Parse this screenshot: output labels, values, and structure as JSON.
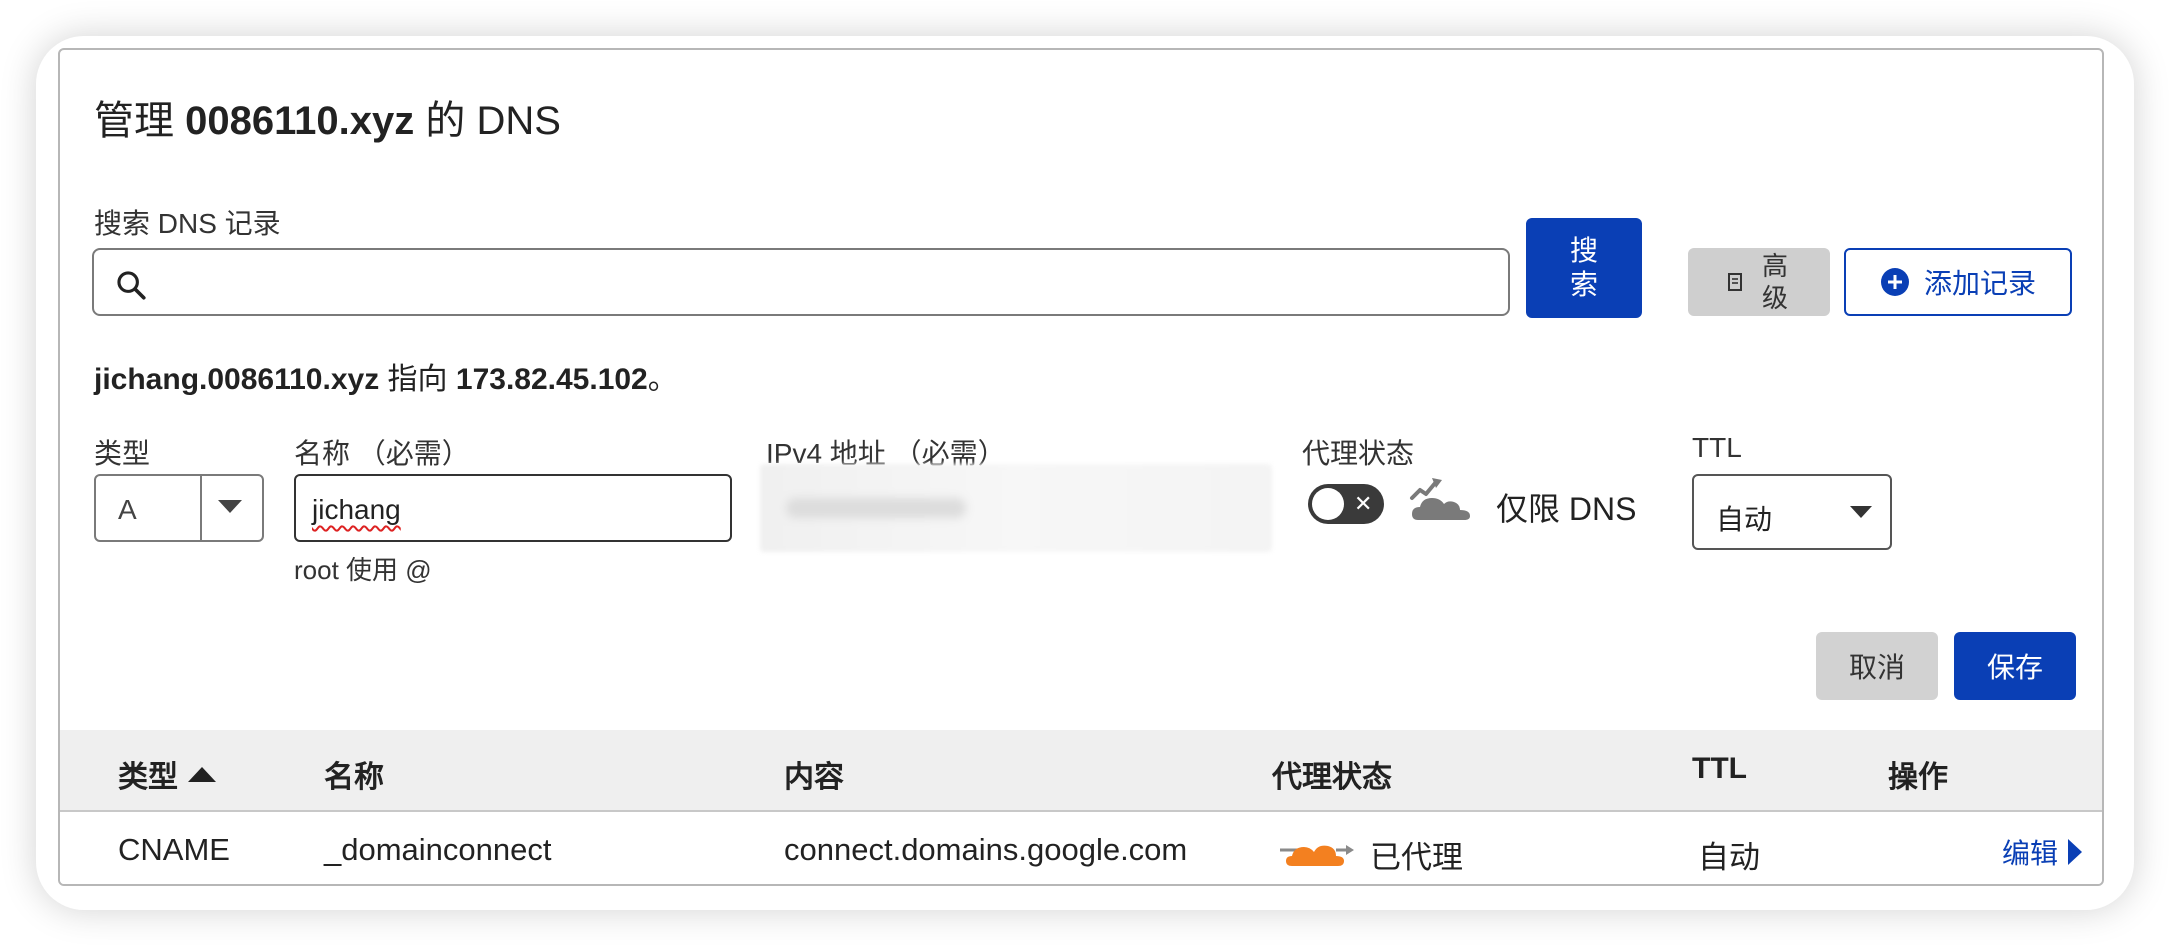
{
  "dialog": {
    "title_prefix": "管理",
    "title_domain": "0086110.xyz",
    "title_suffix": "的 DNS"
  },
  "search": {
    "label": "搜索 DNS 记录",
    "value": "",
    "placeholder": "",
    "button_label": "搜索"
  },
  "toolbar": {
    "advanced_label": "高级",
    "add_record_label": "添加记录"
  },
  "info": {
    "host": "jichang.0086110.xyz",
    "points_to": "指向",
    "ip": "173.82.45.102",
    "end": "。"
  },
  "form": {
    "type_label": "类型",
    "type_value": "A",
    "name_label": "名称 （必需）",
    "name_value": "jichang",
    "name_hint": "root 使用 @",
    "ip_label": "IPv4 地址 （必需）",
    "proxy_label": "代理状态",
    "proxy_text": "仅限 DNS",
    "proxy_enabled": false,
    "ttl_label": "TTL",
    "ttl_value": "自动",
    "cancel_label": "取消",
    "save_label": "保存"
  },
  "table": {
    "headers": [
      "类型",
      "名称",
      "内容",
      "代理状态",
      "TTL",
      "操作"
    ],
    "rows": [
      {
        "type": "CNAME",
        "name": "_domainconnect",
        "content": "connect.domains.google.com",
        "proxy": "已代理",
        "ttl": "自动",
        "action": "编辑"
      }
    ]
  },
  "colors": {
    "primary": "#0a3fb5",
    "proxied_cloud": "#f38020",
    "dns_only_cloud": "#7a7a7a"
  }
}
